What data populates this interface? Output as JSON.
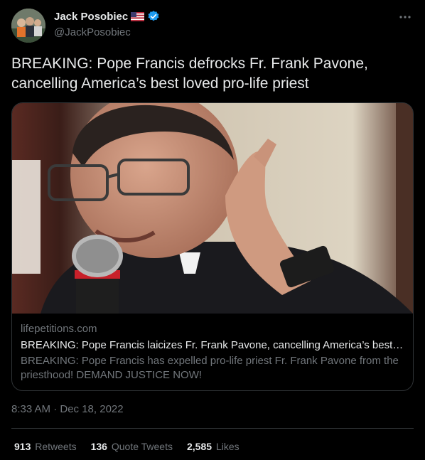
{
  "author": {
    "display_name": "Jack Posobiec",
    "handle": "@JackPosobiec"
  },
  "tweet": {
    "text": "BREAKING: Pope Francis defrocks Fr. Frank Pavone, cancelling America’s best loved pro-life priest",
    "timestamp": "8:33 AM · Dec 18, 2022"
  },
  "card": {
    "domain": "lifepetitions.com",
    "title": "BREAKING: Pope Francis laicizes Fr. Frank Pavone, cancelling America’s best l...",
    "description": "BREAKING: Pope Francis has expelled pro-life priest Fr. Frank Pavone from the priesthood! DEMAND JUSTICE NOW!"
  },
  "stats": {
    "retweets_count": "913",
    "retweets_label": "Retweets",
    "quotes_count": "136",
    "quotes_label": "Quote Tweets",
    "likes_count": "2,585",
    "likes_label": "Likes"
  },
  "colors": {
    "background": "#000000",
    "primary_text": "#e7e9ea",
    "secondary_text": "#71767b",
    "border": "#2f3336",
    "verified_blue": "#1d9bf0"
  },
  "icons": [
    "us-flag-icon",
    "verified-badge-icon",
    "more-options-icon"
  ]
}
